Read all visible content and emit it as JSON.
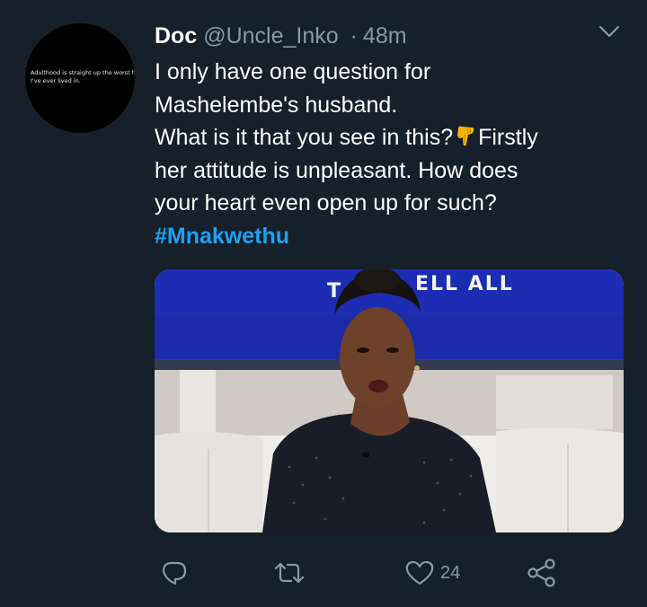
{
  "tweet": {
    "display_name": "Doc",
    "handle": "@Uncle_Inko",
    "separator": "·",
    "time": "48m",
    "avatar_text": [
      "Adulthood is straight up the worst hood",
      "I've ever lived in."
    ],
    "body_lines": [
      "I only have one question for",
      "Mashelembe's husband.",
      "What is it that you see in this?",
      "Firstly",
      "her attitude is unpleasant. How does",
      "your heart even open up for such?"
    ],
    "hashtag": "#Mnakwethu",
    "media": {
      "banner_left": "T",
      "banner_right": "ELL ALL"
    },
    "actions": {
      "like_count": "24"
    }
  },
  "colors": {
    "background": "#15202b",
    "secondary_text": "#8899a6",
    "link": "#1da1f2"
  },
  "icons": [
    "chevron-down-icon",
    "pointing-down-hand-emoji",
    "reply-icon",
    "retweet-icon",
    "like-heart-icon",
    "share-icon"
  ]
}
